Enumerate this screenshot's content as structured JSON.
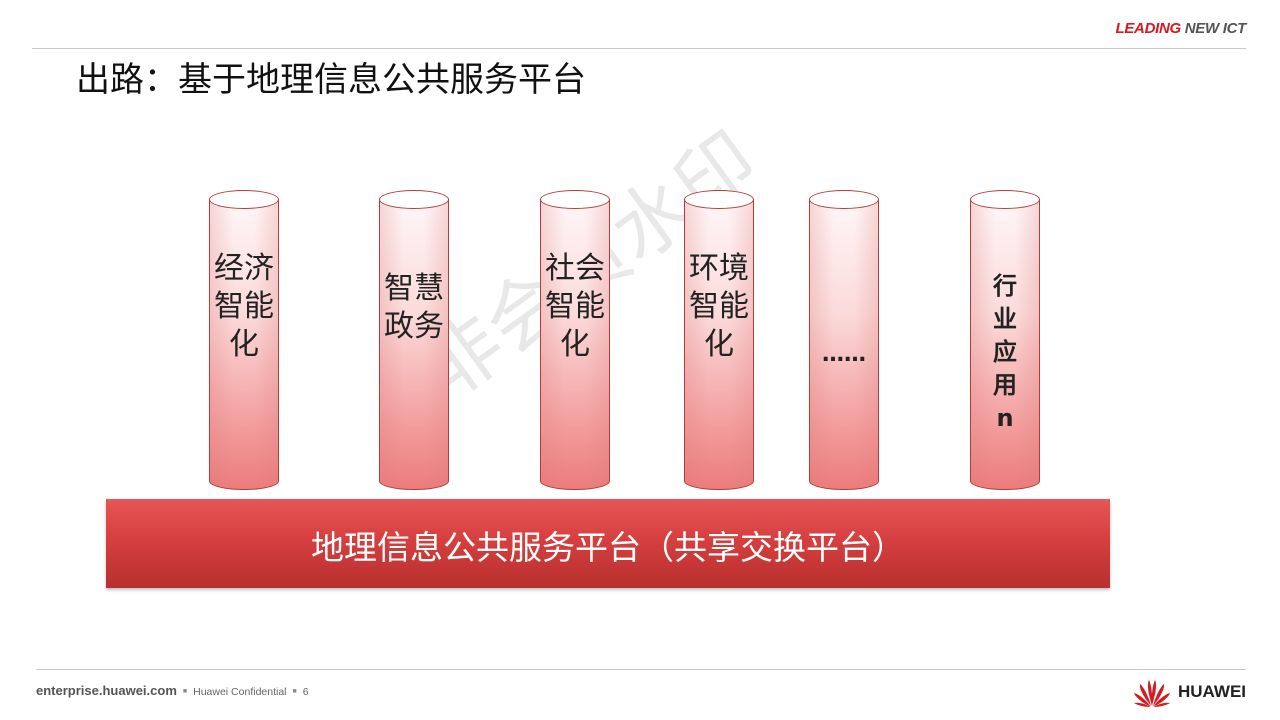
{
  "header": {
    "tagline_part1": "LEADING",
    "tagline_part2": "NEW ICT",
    "title": "出路：基于地理信息公共服务平台"
  },
  "watermark": "非会员水印",
  "pillars": [
    {
      "label": "经济智能化"
    },
    {
      "label": "智慧政务"
    },
    {
      "label": "社会智能化"
    },
    {
      "label": "环境智能化"
    },
    {
      "label": "……"
    },
    {
      "label": "行业应用n"
    }
  ],
  "platform": {
    "label": "地理信息公共服务平台（共享交换平台）"
  },
  "footer": {
    "site": "enterprise.huawei.com",
    "confidential": "Huawei Confidential",
    "page_number": "6",
    "brand": "HUAWEI"
  },
  "colors": {
    "accent_red": "#d71921",
    "platform_red": "#d63f3f",
    "pillar_outline": "#b43c3c"
  },
  "icons": [
    "huawei-logo-icon"
  ]
}
